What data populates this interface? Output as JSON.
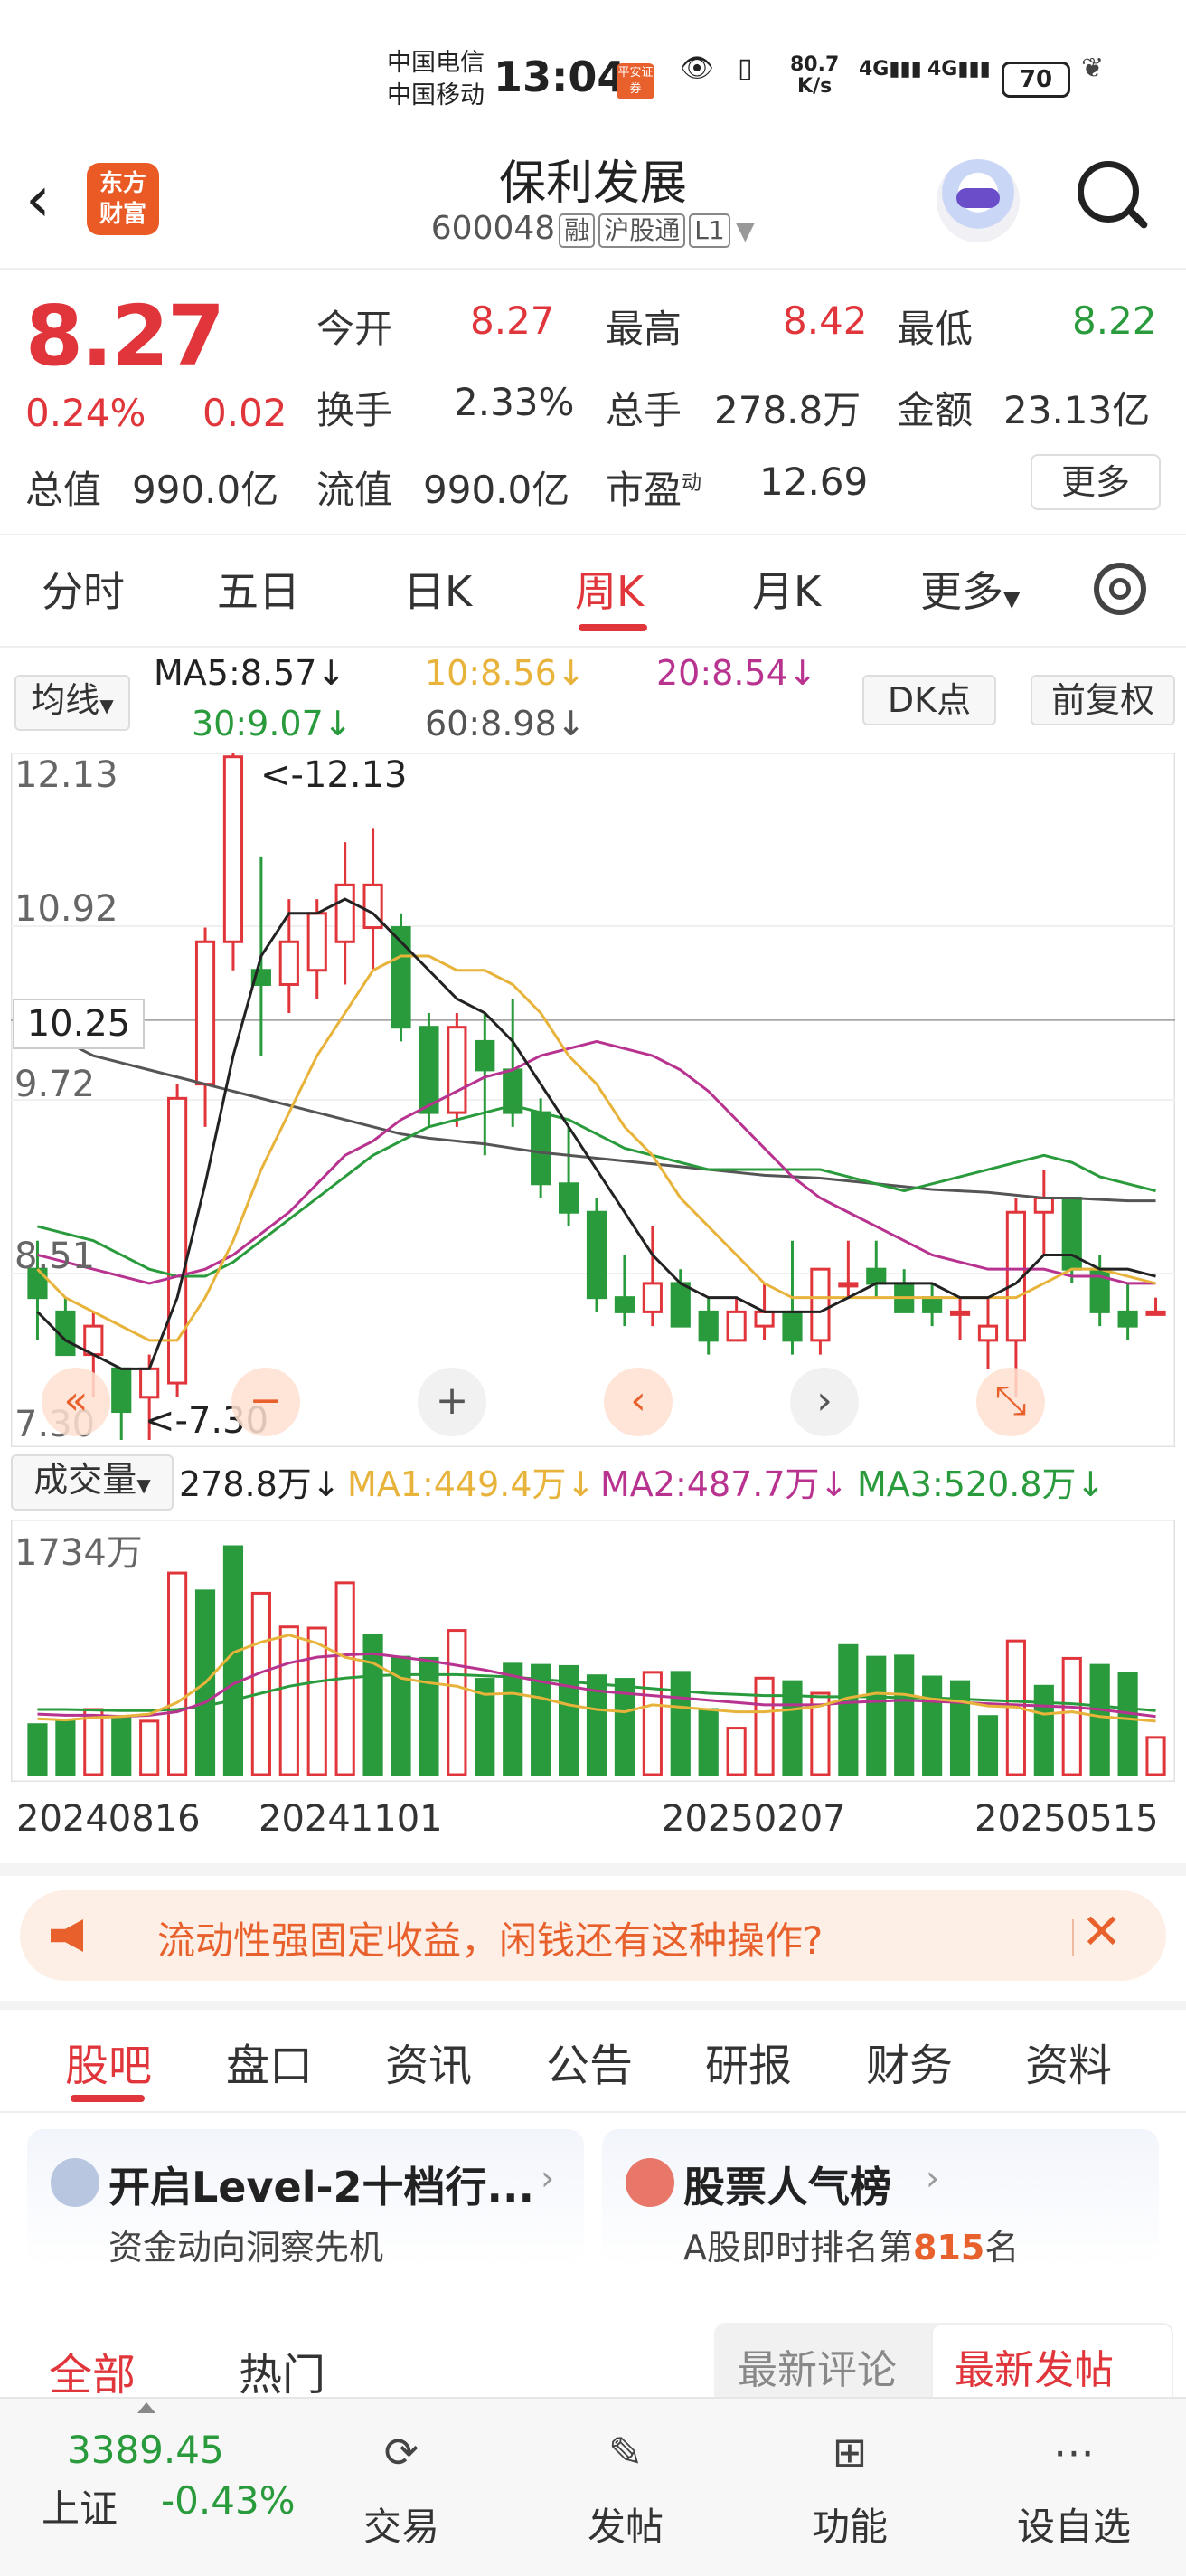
{
  "status_bar": {
    "carrier1": "中国电信",
    "carrier2": "中国移动",
    "time": "13:04",
    "badge": "平安证券",
    "speed": "80.7",
    "speed_unit": "K/s",
    "net1": "4G",
    "net2": "4G",
    "battery": "70"
  },
  "header": {
    "logo_line1": "东方",
    "logo_line2": "财富",
    "title": "保利发展",
    "code": "600048",
    "tags": [
      "融",
      "沪股通",
      "L1"
    ]
  },
  "quote": {
    "price": "8.27",
    "change_pct": "0.24%",
    "change": "0.02",
    "open_label": "今开",
    "open": "8.27",
    "high_label": "最高",
    "high": "8.42",
    "low_label": "最低",
    "low": "8.22",
    "turnover_label": "换手",
    "turnover": "2.33%",
    "volume_label": "总手",
    "volume": "278.8万",
    "amount_label": "金额",
    "amount": "23.13亿",
    "mktcap_label": "总值",
    "mktcap": "990.0亿",
    "float_label": "流值",
    "float": "990.0亿",
    "pe_label": "市盈",
    "pe_sup": "动",
    "pe": "12.69",
    "more": "更多"
  },
  "period_tabs": [
    "分时",
    "五日",
    "日K",
    "周K",
    "月K",
    "更多"
  ],
  "active_period": "周K",
  "ma_bar": {
    "selector": "均线",
    "ma5": "MA5:8.57↓",
    "ma10": "10:8.56↓",
    "ma20": "20:8.54↓",
    "ma30": "30:9.07↓",
    "ma60": "60:8.98↓",
    "dk": "DK点",
    "adjust": "前复权"
  },
  "chart_axis": {
    "y_ticks": [
      "12.13",
      "10.92",
      "9.72",
      "8.51",
      "7.30"
    ],
    "crosshair": "10.25",
    "max_label": "<-12.13",
    "min_label": "<-7.30",
    "dates": [
      "20240816",
      "20241101",
      "20250207",
      "20250515"
    ]
  },
  "volume_bar": {
    "selector": "成交量",
    "vol": "278.8万↓",
    "ma1": "MA1:449.4万↓",
    "ma2": "MA2:487.7万↓",
    "ma3": "MA3:520.8万↓",
    "vmax": "1734万"
  },
  "chart_data": {
    "type": "candlestick",
    "ylim": [
      7.3,
      12.13
    ],
    "candles": [
      [
        8.5,
        8.7,
        8.3,
        8.0
      ],
      [
        8.2,
        8.3,
        7.9,
        7.9
      ],
      [
        7.9,
        8.2,
        8.1,
        7.6
      ],
      [
        7.8,
        7.8,
        7.5,
        7.3
      ],
      [
        7.6,
        7.9,
        7.8,
        7.3
      ],
      [
        7.7,
        9.8,
        9.7,
        7.6
      ],
      [
        9.8,
        10.9,
        10.8,
        9.5
      ],
      [
        10.8,
        12.13,
        12.1,
        10.6
      ],
      [
        10.6,
        11.4,
        10.5,
        10.0
      ],
      [
        10.5,
        11.1,
        10.8,
        10.3
      ],
      [
        10.6,
        11.1,
        11.0,
        10.4
      ],
      [
        10.8,
        11.5,
        11.2,
        10.5
      ],
      [
        10.9,
        11.6,
        11.2,
        10.6
      ],
      [
        10.9,
        11.0,
        10.2,
        10.1
      ],
      [
        10.2,
        10.3,
        9.6,
        9.5
      ],
      [
        9.6,
        10.3,
        10.2,
        9.5
      ],
      [
        10.1,
        10.3,
        9.9,
        9.3
      ],
      [
        9.9,
        10.4,
        9.6,
        9.5
      ],
      [
        9.6,
        9.7,
        9.1,
        9.0
      ],
      [
        9.1,
        9.5,
        8.9,
        8.8
      ],
      [
        8.9,
        9.0,
        8.3,
        8.2
      ],
      [
        8.3,
        8.6,
        8.2,
        8.1
      ],
      [
        8.2,
        8.8,
        8.4,
        8.1
      ],
      [
        8.4,
        8.5,
        8.1,
        8.1
      ],
      [
        8.2,
        8.3,
        8.0,
        7.9
      ],
      [
        8.0,
        8.3,
        8.2,
        8.0
      ],
      [
        8.1,
        8.4,
        8.2,
        8.0
      ],
      [
        8.2,
        8.7,
        8.0,
        7.9
      ],
      [
        8.0,
        8.5,
        8.5,
        7.9
      ],
      [
        8.4,
        8.7,
        8.4,
        8.3
      ],
      [
        8.5,
        8.7,
        8.4,
        8.3
      ],
      [
        8.4,
        8.5,
        8.2,
        8.2
      ],
      [
        8.3,
        8.4,
        8.2,
        8.1
      ],
      [
        8.2,
        8.3,
        8.2,
        8.0
      ],
      [
        8.0,
        8.3,
        8.1,
        7.8
      ],
      [
        8.0,
        9.0,
        8.9,
        7.6
      ],
      [
        8.9,
        9.2,
        9.0,
        8.6
      ],
      [
        9.0,
        9.0,
        8.5,
        8.4
      ],
      [
        8.5,
        8.6,
        8.2,
        8.1
      ],
      [
        8.2,
        8.4,
        8.1,
        8.0
      ],
      [
        8.2,
        8.3,
        8.2,
        8.2
      ]
    ],
    "ma5": [
      8.2,
      8.0,
      7.9,
      7.8,
      7.8,
      8.3,
      9.1,
      10.0,
      10.7,
      11.0,
      11.0,
      11.1,
      11.0,
      10.8,
      10.6,
      10.4,
      10.3,
      10.1,
      9.8,
      9.5,
      9.2,
      8.9,
      8.6,
      8.4,
      8.3,
      8.3,
      8.2,
      8.2,
      8.2,
      8.3,
      8.4,
      8.4,
      8.4,
      8.3,
      8.3,
      8.4,
      8.6,
      8.6,
      8.5,
      8.5,
      8.45
    ],
    "ma10": [
      8.5,
      8.3,
      8.2,
      8.1,
      8.0,
      8.0,
      8.3,
      8.7,
      9.2,
      9.6,
      10.0,
      10.3,
      10.6,
      10.7,
      10.7,
      10.6,
      10.6,
      10.5,
      10.3,
      10.0,
      9.8,
      9.5,
      9.3,
      9.0,
      8.8,
      8.6,
      8.4,
      8.3,
      8.3,
      8.3,
      8.3,
      8.3,
      8.3,
      8.3,
      8.3,
      8.3,
      8.4,
      8.5,
      8.5,
      8.45,
      8.4
    ],
    "ma20": [
      8.6,
      8.55,
      8.5,
      8.45,
      8.4,
      8.45,
      8.5,
      8.6,
      8.75,
      8.9,
      9.1,
      9.3,
      9.4,
      9.55,
      9.65,
      9.75,
      9.85,
      9.9,
      10.0,
      10.05,
      10.1,
      10.05,
      10.0,
      9.9,
      9.75,
      9.55,
      9.35,
      9.15,
      9.0,
      8.9,
      8.8,
      8.7,
      8.6,
      8.55,
      8.5,
      8.5,
      8.5,
      8.45,
      8.45,
      8.4,
      8.4
    ],
    "ma30": [
      8.8,
      8.75,
      8.7,
      8.6,
      8.5,
      8.45,
      8.45,
      8.55,
      8.7,
      8.85,
      9.0,
      9.15,
      9.3,
      9.4,
      9.5,
      9.55,
      9.6,
      9.65,
      9.6,
      9.55,
      9.45,
      9.35,
      9.3,
      9.25,
      9.2,
      9.2,
      9.2,
      9.2,
      9.2,
      9.15,
      9.1,
      9.05,
      9.1,
      9.15,
      9.2,
      9.25,
      9.3,
      9.25,
      9.15,
      9.1,
      9.05
    ],
    "ma60": [
      10.2,
      10.1,
      10.0,
      9.95,
      9.9,
      9.85,
      9.8,
      9.75,
      9.7,
      9.65,
      9.6,
      9.55,
      9.5,
      9.45,
      9.42,
      9.4,
      9.38,
      9.35,
      9.32,
      9.3,
      9.28,
      9.26,
      9.24,
      9.22,
      9.2,
      9.18,
      9.16,
      9.15,
      9.14,
      9.12,
      9.1,
      9.08,
      9.06,
      9.05,
      9.04,
      9.02,
      9.0,
      9.0,
      8.99,
      8.98,
      8.98
    ],
    "volume": [
      430,
      460,
      560,
      490,
      460,
      1734,
      1580,
      1960,
      1560,
      1270,
      1260,
      1650,
      1200,
      1010,
      1000,
      1240,
      820,
      950,
      940,
      930,
      850,
      820,
      880,
      880,
      560,
      400,
      830,
      800,
      700,
      1110,
      1010,
      1020,
      840,
      800,
      500,
      1150,
      760,
      1000,
      940,
      870,
      320
    ],
    "vol_up": [
      false,
      false,
      true,
      false,
      true,
      true,
      false,
      false,
      true,
      true,
      true,
      true,
      false,
      false,
      false,
      true,
      false,
      false,
      false,
      false,
      false,
      false,
      true,
      false,
      false,
      true,
      true,
      false,
      true,
      false,
      false,
      false,
      false,
      false,
      false,
      true,
      false,
      true,
      false,
      false,
      true
    ],
    "vma1": [
      480,
      470,
      490,
      500,
      520,
      620,
      790,
      1050,
      1140,
      1200,
      1130,
      1010,
      960,
      830,
      790,
      760,
      690,
      700,
      660,
      600,
      560,
      540,
      600,
      580,
      560,
      540,
      540,
      560,
      590,
      660,
      700,
      690,
      650,
      630,
      590,
      580,
      520,
      540,
      500,
      480,
      460
    ],
    "vma2": [
      520,
      510,
      510,
      500,
      510,
      540,
      620,
      780,
      880,
      960,
      1010,
      1030,
      1040,
      1010,
      980,
      940,
      900,
      850,
      800,
      760,
      720,
      700,
      680,
      660,
      640,
      620,
      600,
      600,
      600,
      620,
      630,
      640,
      630,
      620,
      610,
      600,
      590,
      580,
      560,
      530,
      500
    ],
    "vma3": [
      560,
      560,
      555,
      550,
      550,
      560,
      590,
      640,
      700,
      760,
      800,
      830,
      850,
      860,
      860,
      860,
      850,
      840,
      820,
      800,
      780,
      760,
      740,
      720,
      700,
      690,
      680,
      680,
      670,
      670,
      670,
      660,
      660,
      650,
      640,
      630,
      620,
      610,
      590,
      570,
      550
    ]
  },
  "ad": {
    "text": "流动性强固定收益，闲钱还有这种操作?"
  },
  "content_tabs": [
    "股吧",
    "盘口",
    "资讯",
    "公告",
    "研报",
    "财务",
    "资料"
  ],
  "cards": {
    "left_title": "开启Level-2十档行...",
    "left_sub": "资金动向洞察先机",
    "right_title": "股票人气榜",
    "right_sub_pre": "A股即时排名第",
    "right_rank": "815",
    "right_sub_post": "名"
  },
  "feed_tabs": {
    "all": "全部",
    "hot": "热门",
    "latest_comment": "最新评论",
    "latest_post": "最新发帖"
  },
  "bottom_nav": {
    "index_value": "3389.45",
    "index_name": "上证",
    "index_change": "-0.43%",
    "items": [
      "交易",
      "发帖",
      "功能",
      "设自选"
    ]
  },
  "colors": {
    "up": "#e0353b",
    "down": "#2a9b3c",
    "accent": "#e8602c",
    "ma10": "#e8b33b",
    "ma20": "#b8338f"
  }
}
